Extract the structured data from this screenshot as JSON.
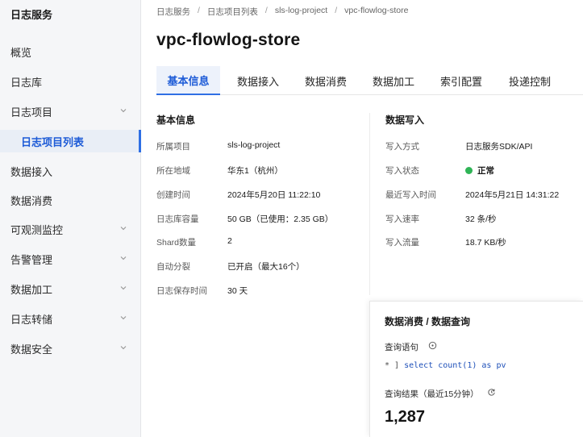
{
  "sidebar": {
    "title": "日志服务",
    "items": [
      {
        "label": "概览",
        "chevron": false
      },
      {
        "label": "日志库",
        "chevron": false
      },
      {
        "label": "日志项目",
        "chevron": true
      },
      {
        "label": "日志项目列表",
        "chevron": false,
        "active": true,
        "sub": true
      },
      {
        "label": "数据接入",
        "chevron": false
      },
      {
        "label": "数据消费",
        "chevron": false
      },
      {
        "label": "可观测监控",
        "chevron": true
      },
      {
        "label": "告警管理",
        "chevron": true
      },
      {
        "label": "数据加工",
        "chevron": true
      },
      {
        "label": "日志转储",
        "chevron": true
      },
      {
        "label": "数据安全",
        "chevron": true
      }
    ]
  },
  "breadcrumb": [
    "日志服务",
    "日志项目列表",
    "sls-log-project",
    "vpc-flowlog-store"
  ],
  "page_title": "vpc-flowlog-store",
  "tabs": [
    "基本信息",
    "数据接入",
    "数据消费",
    "数据加工",
    "索引配置",
    "投递控制"
  ],
  "basic_info": {
    "title": "基本信息",
    "rows": [
      {
        "label": "所属项目",
        "value": "sls-log-project"
      },
      {
        "label": "所在地域",
        "value": "华东1（杭州）"
      },
      {
        "label": "创建时间",
        "value": "2024年5月20日 11:22:10"
      },
      {
        "label": "日志库容量",
        "value": "50 GB（已使用：2.35 GB）"
      },
      {
        "label": "Shard数量",
        "value": "2"
      },
      {
        "label": "自动分裂",
        "value": "已开启（最大16个）"
      },
      {
        "label": "日志保存时间",
        "value": "30 天"
      }
    ]
  },
  "data_write": {
    "title": "数据写入",
    "rows": [
      {
        "label": "写入方式",
        "value": "日志服务SDK/API"
      },
      {
        "label": "写入状态",
        "value": "正常",
        "status_color": "#2fb456"
      },
      {
        "label": "最近写入时间",
        "value": "2024年5月21日 14:31:22"
      },
      {
        "label": "写入速率",
        "value": "32 条/秒"
      },
      {
        "label": "写入流量",
        "value": "18.7 KB/秒"
      }
    ]
  },
  "query_panel": {
    "title": "数据消费 / 数据查询",
    "statement_label": "查询语句",
    "prompt": "* ]",
    "statement": "select count(1) as pv",
    "result_label": "查询结果（最近15分钟）",
    "result_value": "1,287"
  },
  "colors": {
    "accent": "#2f6fe4",
    "status_ok": "#2fb456"
  }
}
